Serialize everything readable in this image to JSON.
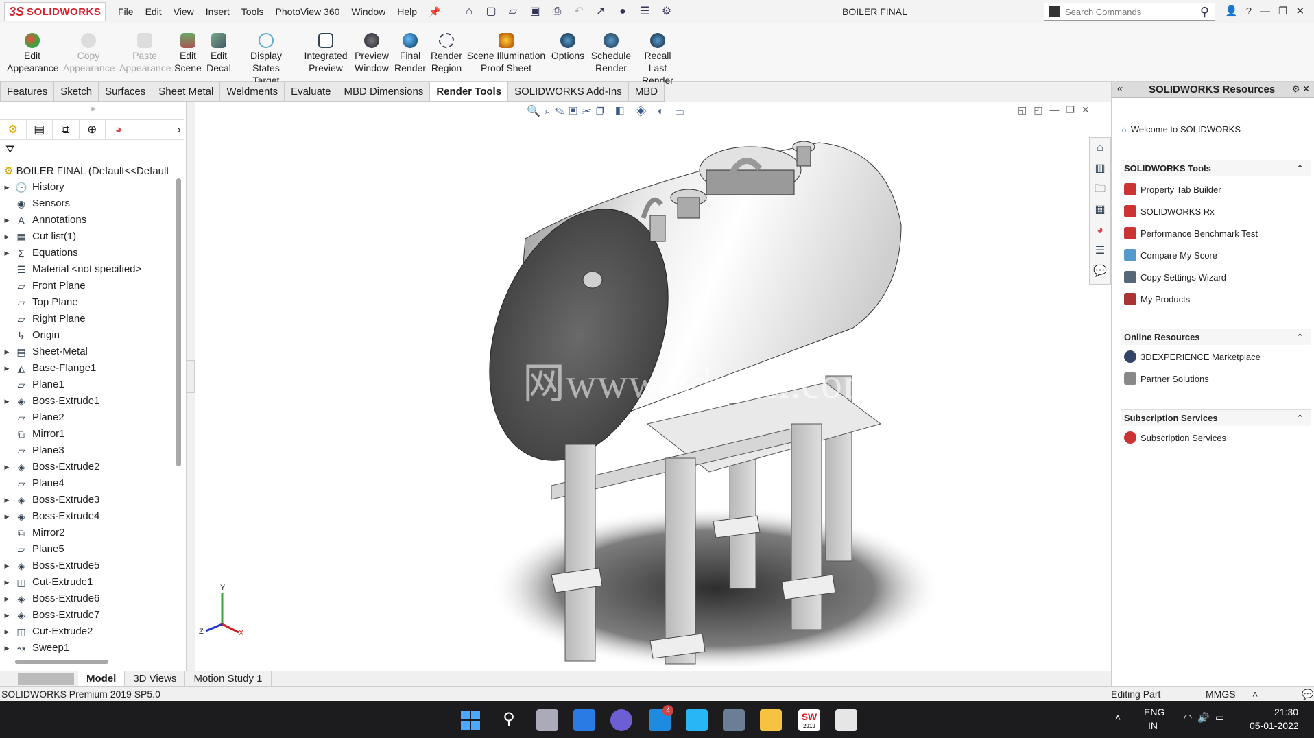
{
  "app": {
    "logo_prefix": "3S",
    "logo_text": "SOLIDWORKS",
    "document_title": "BOILER FINAL"
  },
  "menu": [
    "File",
    "Edit",
    "View",
    "Insert",
    "Tools",
    "PhotoView 360",
    "Window",
    "Help"
  ],
  "search": {
    "placeholder": "Search Commands"
  },
  "ribbon": [
    {
      "label1": "Edit",
      "label2": "Appearance",
      "icon": "appearance-icon",
      "enabled": true
    },
    {
      "label1": "Copy",
      "label2": "Appearance",
      "icon": "copy-appearance-icon",
      "enabled": false
    },
    {
      "label1": "Paste",
      "label2": "Appearance",
      "icon": "paste-appearance-icon",
      "enabled": false
    },
    {
      "label1": "Edit",
      "label2": "Scene",
      "icon": "scene-icon",
      "enabled": true
    },
    {
      "label1": "Edit",
      "label2": "Decal",
      "icon": "decal-icon",
      "enabled": true
    },
    {
      "label1": "Display States",
      "label2": "Target",
      "icon": "display-states-icon",
      "enabled": true
    },
    {
      "label1": "Integrated",
      "label2": "Preview",
      "icon": "integrated-preview-icon",
      "enabled": true
    },
    {
      "label1": "Preview",
      "label2": "Window",
      "icon": "preview-window-icon",
      "enabled": true
    },
    {
      "label1": "Final",
      "label2": "Render",
      "icon": "final-render-icon",
      "enabled": true
    },
    {
      "label1": "Render",
      "label2": "Region",
      "icon": "render-region-icon",
      "enabled": true
    },
    {
      "label1": "Scene Illumination",
      "label2": "Proof Sheet",
      "icon": "illumination-icon",
      "enabled": true
    },
    {
      "label1": "Options",
      "label2": "",
      "icon": "options-icon",
      "enabled": true
    },
    {
      "label1": "Schedule",
      "label2": "Render",
      "icon": "schedule-render-icon",
      "enabled": true
    },
    {
      "label1": "Recall Last",
      "label2": "Render",
      "icon": "recall-render-icon",
      "enabled": true
    }
  ],
  "command_tabs": [
    "Features",
    "Sketch",
    "Surfaces",
    "Sheet Metal",
    "Weldments",
    "Evaluate",
    "MBD Dimensions",
    "Render Tools",
    "SOLIDWORKS Add-Ins",
    "MBD"
  ],
  "active_command_tab": "Render Tools",
  "tree": {
    "root": "BOILER FINAL  (Default<<Default",
    "items": [
      {
        "label": "History",
        "icon": "history-icon",
        "expand": true
      },
      {
        "label": "Sensors",
        "icon": "sensor-icon",
        "expand": false
      },
      {
        "label": "Annotations",
        "icon": "annotation-icon",
        "expand": true
      },
      {
        "label": "Cut list(1)",
        "icon": "cut-list-icon",
        "expand": true
      },
      {
        "label": "Equations",
        "icon": "equation-icon",
        "expand": true
      },
      {
        "label": "Material <not specified>",
        "icon": "material-icon",
        "expand": false
      },
      {
        "label": "Front Plane",
        "icon": "plane-icon",
        "expand": false
      },
      {
        "label": "Top Plane",
        "icon": "plane-icon",
        "expand": false
      },
      {
        "label": "Right Plane",
        "icon": "plane-icon",
        "expand": false
      },
      {
        "label": "Origin",
        "icon": "origin-icon",
        "expand": false
      },
      {
        "label": "Sheet-Metal",
        "icon": "sheet-metal-icon",
        "expand": true
      },
      {
        "label": "Base-Flange1",
        "icon": "base-flange-icon",
        "expand": true
      },
      {
        "label": "Plane1",
        "icon": "plane-icon",
        "expand": false
      },
      {
        "label": "Boss-Extrude1",
        "icon": "boss-extrude-icon",
        "expand": true
      },
      {
        "label": "Plane2",
        "icon": "plane-icon",
        "expand": false
      },
      {
        "label": "Mirror1",
        "icon": "mirror-icon",
        "expand": false
      },
      {
        "label": "Plane3",
        "icon": "plane-icon",
        "expand": false
      },
      {
        "label": "Boss-Extrude2",
        "icon": "boss-extrude-icon",
        "expand": true
      },
      {
        "label": "Plane4",
        "icon": "plane-icon",
        "expand": false
      },
      {
        "label": "Boss-Extrude3",
        "icon": "boss-extrude-icon",
        "expand": true
      },
      {
        "label": "Boss-Extrude4",
        "icon": "boss-extrude-icon",
        "expand": true
      },
      {
        "label": "Mirror2",
        "icon": "mirror-icon",
        "expand": false
      },
      {
        "label": "Plane5",
        "icon": "plane-icon",
        "expand": false
      },
      {
        "label": "Boss-Extrude5",
        "icon": "boss-extrude-icon",
        "expand": true
      },
      {
        "label": "Cut-Extrude1",
        "icon": "cut-extrude-icon",
        "expand": true
      },
      {
        "label": "Boss-Extrude6",
        "icon": "boss-extrude-icon",
        "expand": true
      },
      {
        "label": "Boss-Extrude7",
        "icon": "boss-extrude-icon",
        "expand": true
      },
      {
        "label": "Cut-Extrude2",
        "icon": "cut-extrude-icon",
        "expand": true
      },
      {
        "label": "Sweep1",
        "icon": "sweep-icon",
        "expand": true
      }
    ]
  },
  "viewport": {
    "watermark": "网www.3dmox.com",
    "triad": {
      "y": "Y",
      "z": "Z",
      "x": "X"
    }
  },
  "bottom_tabs": [
    "Model",
    "3D Views",
    "Motion Study 1"
  ],
  "active_bottom_tab": "Model",
  "status": {
    "version": "SOLIDWORKS Premium 2019 SP5.0",
    "mode": "Editing Part",
    "units": "MMGS"
  },
  "resources": {
    "title": "SOLIDWORKS Resources",
    "welcome": "Welcome to SOLIDWORKS",
    "sections": [
      {
        "title": "SOLIDWORKS Tools",
        "items": [
          "Property Tab Builder",
          "SOLIDWORKS Rx",
          "Performance Benchmark Test",
          "Compare My Score",
          "Copy Settings Wizard",
          "My Products"
        ]
      },
      {
        "title": "Online Resources",
        "items": [
          "3DEXPERIENCE Marketplace",
          "Partner Solutions"
        ]
      },
      {
        "title": "Subscription Services",
        "items": [
          "Subscription Services"
        ]
      }
    ]
  },
  "taskbar": {
    "mail_badge": "4",
    "sw_label": "SW",
    "sw_year": "2019",
    "lang1": "ENG",
    "lang2": "IN",
    "time": "21:30",
    "date": "05-01-2022"
  },
  "colors": {
    "brand": "#d42027",
    "taskbar": "#1c1c1e",
    "accent": "#3a5a8a"
  }
}
